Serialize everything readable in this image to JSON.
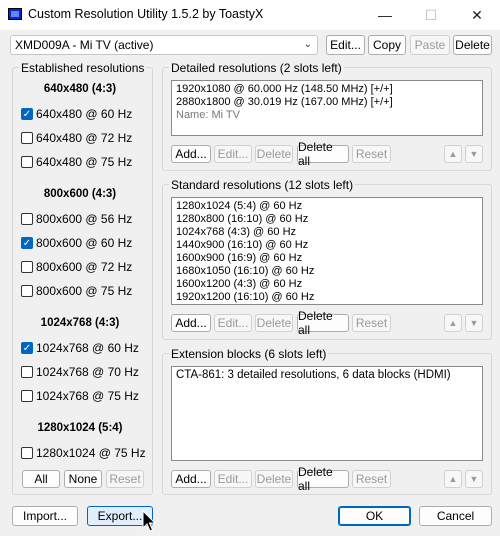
{
  "window": {
    "title": "Custom Resolution Utility 1.5.2 by ToastyX",
    "min": "—",
    "max": "☐",
    "close": "✕"
  },
  "toolbar": {
    "monitor": "XMD009A - Mi TV (active)",
    "edit": "Edit...",
    "copy": "Copy",
    "paste": "Paste",
    "delete": "Delete"
  },
  "established": {
    "title": "Established resolutions",
    "groups": [
      {
        "header": "640x480 (4:3)",
        "items": [
          {
            "label": "640x480 @ 60 Hz",
            "checked": true
          },
          {
            "label": "640x480 @ 72 Hz",
            "checked": false
          },
          {
            "label": "640x480 @ 75 Hz",
            "checked": false
          }
        ]
      },
      {
        "header": "800x600 (4:3)",
        "items": [
          {
            "label": "800x600 @ 56 Hz",
            "checked": false
          },
          {
            "label": "800x600 @ 60 Hz",
            "checked": true
          },
          {
            "label": "800x600 @ 72 Hz",
            "checked": false
          },
          {
            "label": "800x600 @ 75 Hz",
            "checked": false
          }
        ]
      },
      {
        "header": "1024x768 (4:3)",
        "items": [
          {
            "label": "1024x768 @ 60 Hz",
            "checked": true
          },
          {
            "label": "1024x768 @ 70 Hz",
            "checked": false
          },
          {
            "label": "1024x768 @ 75 Hz",
            "checked": false
          }
        ]
      },
      {
        "header": "1280x1024 (5:4)",
        "items": [
          {
            "label": "1280x1024 @ 75 Hz",
            "checked": false
          }
        ]
      }
    ],
    "all": "All",
    "none": "None",
    "reset": "Reset"
  },
  "detailed": {
    "title": "Detailed resolutions (2 slots left)",
    "lines": [
      "1920x1080 @ 60.000 Hz (148.50 MHz) [+/+]",
      "2880x1800 @ 30.019 Hz (167.00 MHz) [+/+]"
    ],
    "name_line": "Name: Mi TV"
  },
  "standard": {
    "title": "Standard resolutions (12 slots left)",
    "lines": [
      "1280x1024 (5:4) @ 60 Hz",
      "1280x800 (16:10) @ 60 Hz",
      "1024x768 (4:3) @ 60 Hz",
      "1440x900 (16:10) @ 60 Hz",
      "1600x900 (16:9) @ 60 Hz",
      "1680x1050 (16:10) @ 60 Hz",
      "1600x1200 (4:3) @ 60 Hz",
      "1920x1200 (16:10) @ 60 Hz"
    ]
  },
  "extension": {
    "title": "Extension blocks (6 slots left)",
    "lines": [
      "CTA-861: 3 detailed resolutions, 6 data blocks (HDMI)"
    ]
  },
  "list_buttons": {
    "add": "Add...",
    "edit": "Edit...",
    "delete": "Delete",
    "delete_all": "Delete all",
    "reset": "Reset",
    "up": "▲",
    "down": "▼"
  },
  "footer": {
    "import": "Import...",
    "export": "Export...",
    "ok": "OK",
    "cancel": "Cancel"
  },
  "colors": {
    "accent": "#0067c0"
  }
}
